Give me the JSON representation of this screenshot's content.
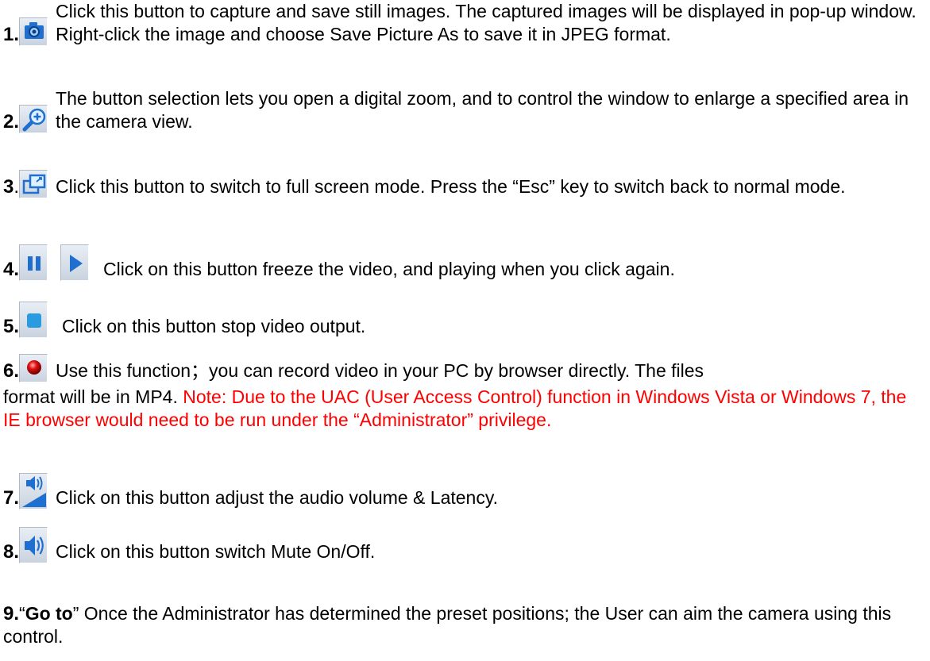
{
  "items": [
    {
      "number": "1.",
      "icon": "camera-icon",
      "text": "Click this button to capture and save still images. The captured images will be displayed in pop-up window. Right-click the image and choose Save Picture As to save it in JPEG format."
    },
    {
      "number": "2.",
      "icon": "zoom-in-icon",
      "text": "The button selection lets you open a digital zoom, and to control the window to enlarge a specified area in the camera view."
    },
    {
      "number": "3",
      "number_suffix": ".",
      "icon": "fullscreen-icon",
      "text": "Click this button to switch to full screen mode. Press the “Esc” key to switch back to normal mode."
    },
    {
      "number": "4.",
      "icon": "pause-icon",
      "icon2": "play-icon",
      "text": "Click on this button freeze the video, and playing when you click again."
    },
    {
      "number": "5.",
      "icon": "stop-icon",
      "text": "Click on this button stop video output."
    },
    {
      "number": "6.",
      "icon": "record-icon",
      "text": "Use this function；you can record video in your PC by browser directly. The files format will be in MP4.",
      "note": "Note: Due to the UAC (User Access Control) function in Windows Vista or Windows 7, the IE browser would need to be run under the “Administrator” privilege."
    },
    {
      "number": "7.",
      "icon": "volume-adjust-icon",
      "text": "Click on this button adjust the audio volume & Latency."
    },
    {
      "number": "8.",
      "icon": "speaker-icon",
      "text": "Click on this button switch Mute On/Off."
    },
    {
      "number": "9.",
      "quote_open": "“",
      "bold": "Go to",
      "quote_close": "”",
      "text": "Once the Administrator has determined the preset positions; the User can aim the camera using this control."
    }
  ],
  "colors": {
    "text": "#000000",
    "note": "#ff0000",
    "icon_blue": "#1e6fd0",
    "record_red": "#d40000"
  }
}
